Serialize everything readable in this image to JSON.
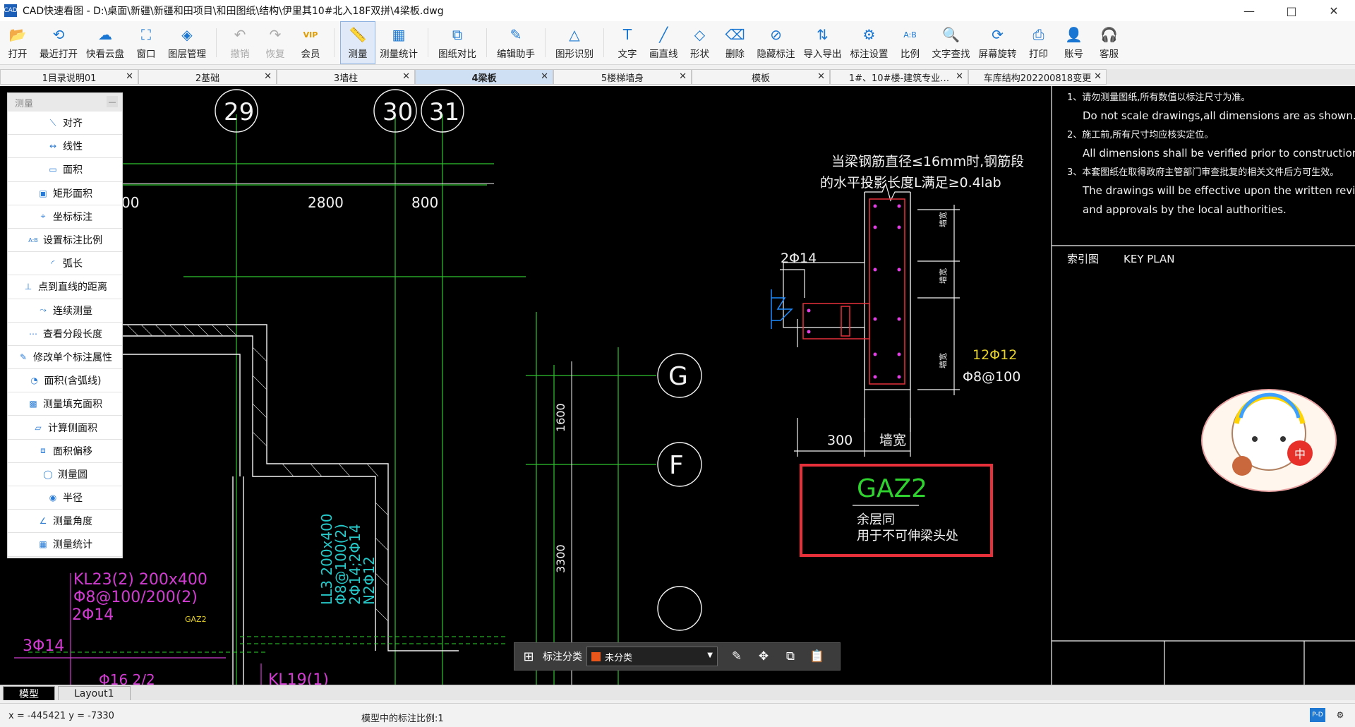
{
  "window": {
    "title": "CAD快速看图 - D:\\桌面\\新疆\\新疆和田项目\\和田图纸\\结构\\伊里其10#北入18F双拼\\4梁板.dwg",
    "app_icon": "CAD",
    "minimize": "—",
    "maximize": "□",
    "close": "✕"
  },
  "toolbar": {
    "items": [
      {
        "label": "打开",
        "icon": "folder-open-icon",
        "glyph": "📂"
      },
      {
        "label": "最近打开",
        "icon": "history-icon",
        "glyph": "⟲"
      },
      {
        "label": "快看云盘",
        "icon": "cloud-icon",
        "glyph": "☁"
      },
      {
        "label": "窗口",
        "icon": "window-icon",
        "glyph": "⛶"
      },
      {
        "label": "图层管理",
        "icon": "layers-icon",
        "glyph": "◈"
      },
      {
        "label": "撤销",
        "icon": "undo-icon",
        "glyph": "↶"
      },
      {
        "label": "恢复",
        "icon": "redo-icon",
        "glyph": "↷"
      },
      {
        "label": "会员",
        "icon": "vip-icon",
        "glyph": "VIP"
      },
      {
        "label": "测量",
        "icon": "ruler-icon",
        "glyph": "📏"
      },
      {
        "label": "测量统计",
        "icon": "measure-stats-icon",
        "glyph": "▦"
      },
      {
        "label": "图纸对比",
        "icon": "compare-icon",
        "glyph": "⧉"
      },
      {
        "label": "编辑助手",
        "icon": "edit-assistant-icon",
        "glyph": "✎"
      },
      {
        "label": "图形识别",
        "icon": "shape-recognize-icon",
        "glyph": "△"
      },
      {
        "label": "文字",
        "icon": "text-icon",
        "glyph": "T"
      },
      {
        "label": "画直线",
        "icon": "line-icon",
        "glyph": "╱"
      },
      {
        "label": "形状",
        "icon": "shape-icon",
        "glyph": "◇"
      },
      {
        "label": "删除",
        "icon": "eraser-icon",
        "glyph": "⌫"
      },
      {
        "label": "隐藏标注",
        "icon": "hide-annotation-icon",
        "glyph": "⊘"
      },
      {
        "label": "导入导出",
        "icon": "import-export-icon",
        "glyph": "⇅"
      },
      {
        "label": "标注设置",
        "icon": "annotation-settings-icon",
        "glyph": "⚙"
      },
      {
        "label": "比例",
        "icon": "scale-icon",
        "glyph": "A:B"
      },
      {
        "label": "文字查找",
        "icon": "text-search-icon",
        "glyph": "🔍"
      },
      {
        "label": "屏幕旋转",
        "icon": "rotate-screen-icon",
        "glyph": "⟳"
      },
      {
        "label": "打印",
        "icon": "print-icon",
        "glyph": "⎙"
      },
      {
        "label": "账号",
        "icon": "account-icon",
        "glyph": "👤"
      },
      {
        "label": "客服",
        "icon": "headset-icon",
        "glyph": "🎧"
      }
    ]
  },
  "tabs": [
    {
      "label": "1目录说明01",
      "close": "✕"
    },
    {
      "label": "2基础",
      "close": "✕"
    },
    {
      "label": "3墙柱",
      "close": "✕"
    },
    {
      "label": "4梁板",
      "close": "✕"
    },
    {
      "label": "5楼梯墙身",
      "close": "✕"
    },
    {
      "label": "模板",
      "close": "✕"
    },
    {
      "label": "1#、10#楼-建筑专业…",
      "close": "✕"
    },
    {
      "label": "车库结构202200818变更",
      "close": "✕"
    }
  ],
  "measure_panel": {
    "title": "测量",
    "minimize": "—",
    "items": [
      {
        "label": "对齐",
        "icon": "align-measure-icon",
        "glyph": "⟍"
      },
      {
        "label": "线性",
        "icon": "linear-measure-icon",
        "glyph": "↔"
      },
      {
        "label": "面积",
        "icon": "area-icon",
        "glyph": "▭"
      },
      {
        "label": "矩形面积",
        "icon": "rect-area-icon",
        "glyph": "▣"
      },
      {
        "label": "坐标标注",
        "icon": "coordinate-icon",
        "glyph": "⌖"
      },
      {
        "label": "设置标注比例",
        "icon": "set-scale-icon",
        "glyph": "A:B"
      },
      {
        "label": "弧长",
        "icon": "arc-length-icon",
        "glyph": "◜"
      },
      {
        "label": "点到直线的距离",
        "icon": "point-line-distance-icon",
        "glyph": "⊥"
      },
      {
        "label": "连续测量",
        "icon": "continuous-measure-icon",
        "glyph": "⤳"
      },
      {
        "label": "查看分段长度",
        "icon": "segment-length-icon",
        "glyph": "⋯"
      },
      {
        "label": "修改单个标注属性",
        "icon": "edit-annotation-icon",
        "glyph": "✎"
      },
      {
        "label": "面积(含弧线)",
        "icon": "arc-area-icon",
        "glyph": "◔"
      },
      {
        "label": "测量填充面积",
        "icon": "fill-area-icon",
        "glyph": "▩"
      },
      {
        "label": "计算侧面积",
        "icon": "side-area-icon",
        "glyph": "▱"
      },
      {
        "label": "面积偏移",
        "icon": "area-offset-icon",
        "glyph": "⧈"
      },
      {
        "label": "测量圆",
        "icon": "circle-measure-icon",
        "glyph": "◯"
      },
      {
        "label": "半径",
        "icon": "radius-icon",
        "glyph": "◉"
      },
      {
        "label": "测量角度",
        "icon": "angle-icon",
        "glyph": "∠"
      },
      {
        "label": "测量统计",
        "icon": "stats-icon",
        "glyph": "▦"
      }
    ]
  },
  "drawing": {
    "axis_labels": [
      "29",
      "30",
      "31",
      "G",
      "F"
    ],
    "dims": [
      "2800",
      "800",
      "00",
      "1600",
      "3300"
    ],
    "note_lines": [
      "当梁钢筋直径≤16mm时,钢筋段",
      "的水平投影长度L满足≥0.4lab"
    ],
    "rebar_2d14": "2Φ14",
    "rebar_12d12": "12Φ12",
    "stirrup": "Φ8@100",
    "dim_300": "300",
    "wall_width": "墙宽",
    "side_labels": [
      "墙宽",
      "墙宽",
      "墙宽"
    ],
    "gaz2_title": "GAZ2",
    "gaz2_line1": "余层同",
    "gaz2_line2": "用于不可伸梁头处",
    "kl23_line1": "KL23(2) 200x400",
    "kl23_line2": "Φ8@100/200(2)",
    "kl23_line3": "2Φ14",
    "rebar_3d14": "3Φ14",
    "rebar_bottom": "Φ16 2/2",
    "kl19": "KL19(1)",
    "gaz_small": "GAZ2",
    "ll3_line1": "LL3 200x400",
    "ll3_line2": "Φ8@100(2)",
    "ll3_line3": "2Φ14;2Φ14",
    "ll3_line4": "N2Φ12",
    "notes": [
      "1、请勿测量图纸,所有数值以标注尺寸为准。",
      "Do not scale drawings,all dimensions are as shown.",
      "2、施工前,所有尺寸均应核实定位。",
      "All dimensions shall be verified prior to construction.",
      "3、本套图纸在取得政府主管部门审查批复的相关文件后方可生效。",
      "The drawings will be effective upon the written revie",
      "and approvals by the local authorities."
    ],
    "key_plan_cn": "索引图",
    "key_plan_en": "KEY PLAN",
    "sticker_text": "中"
  },
  "annotation_bar": {
    "grid_icon": "grid-icon",
    "label": "标注分类",
    "selected": "未分类",
    "swatch_color": "#e8561c",
    "tools": [
      "edit-icon",
      "move-icon",
      "copy-icon",
      "paste-icon"
    ]
  },
  "bottom_tabs": [
    "模型",
    "Layout1"
  ],
  "status": {
    "coord": "x = -445421  y = -7330",
    "scale": "模型中的标注比例:1"
  },
  "colors": {
    "canvas": "#000000",
    "grid_line": "#2fc22f",
    "axis_circle": "#ffffff",
    "red_frame": "#e8303a",
    "magenta_text": "#d23cd2",
    "cyan_text": "#26c9c9",
    "gaz_green": "#2fd22f"
  }
}
